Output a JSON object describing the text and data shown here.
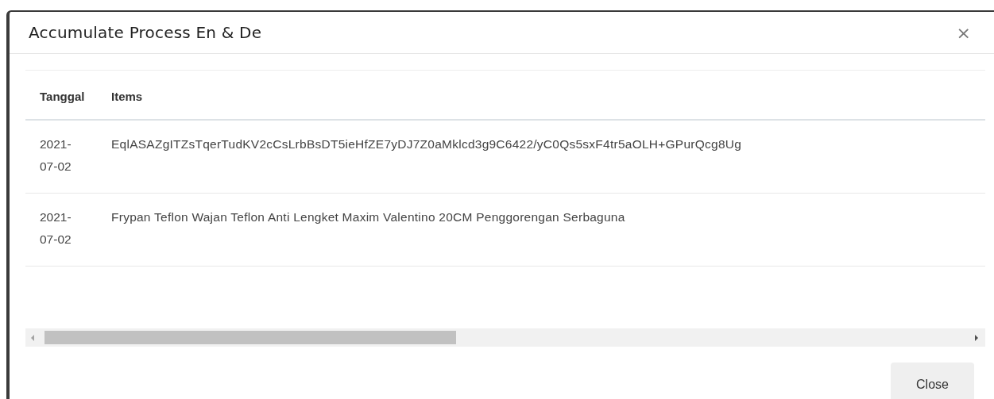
{
  "dialog": {
    "title": "Accumulate Process En & De",
    "close_label": "×"
  },
  "table": {
    "columns": [
      "Tanggal",
      "Items"
    ],
    "rows": [
      {
        "cells": [
          "2021-\n07-02",
          "EqlASAZgITZsTqerTudKV2cCsLrbBsDT5ieHfZE7yDJ7Z0aMklcd3g9C6422/yC0Qs5sxF4tr5aOLH+GPurQcg8Ug"
        ]
      },
      {
        "cells": [
          "2021-\n07-02",
          "Frypan Teflon Wajan Teflon Anti Lengket Maxim Valentino 20CM Penggorengan Serbaguna"
        ]
      }
    ]
  },
  "footer": {
    "buttons": [
      "Close"
    ]
  }
}
